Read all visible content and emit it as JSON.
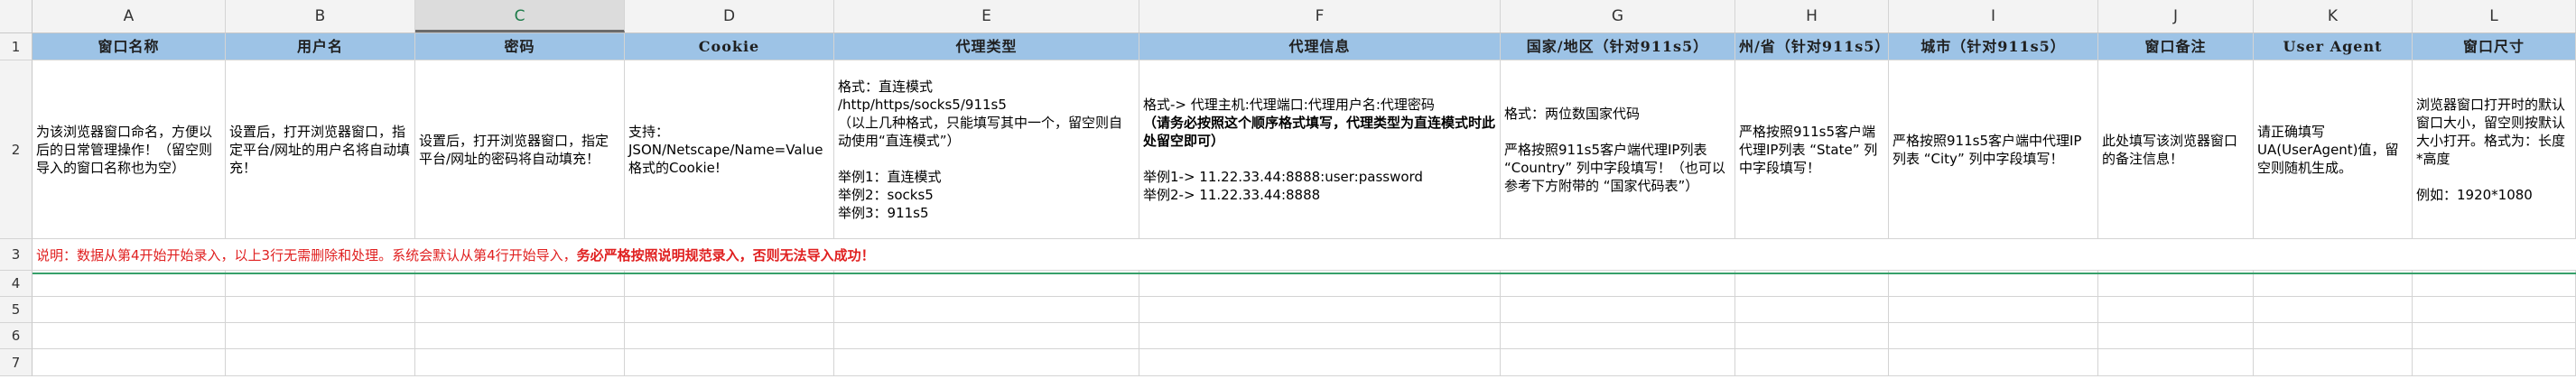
{
  "columns": [
    "A",
    "B",
    "C",
    "D",
    "E",
    "F",
    "G",
    "H",
    "I",
    "J",
    "K",
    "L"
  ],
  "row_numbers": [
    "1",
    "2",
    "3",
    "4",
    "5",
    "6",
    "7"
  ],
  "headers": [
    "窗口名称",
    "用户名",
    "密码",
    "Cookie",
    "代理类型",
    "代理信息",
    "国家/地区（针对911s5）",
    "州/省（针对911s5）",
    "城市（针对911s5）",
    "窗口备注",
    "User Agent",
    "窗口尺寸"
  ],
  "descriptions": {
    "a": "为该浏览器窗口命名，方便以后的日常管理操作！（留空则导入的窗口名称也为空）",
    "b": "设置后，打开浏览器窗口，指定平台/网址的用户名将自动填充！",
    "c": "设置后，打开浏览器窗口，指定平台/网址的密码将自动填充！",
    "d": "支持：\nJSON/Netscape/Name=Value格式的Cookie!",
    "e": "格式：直连模式\n/http/https/socks5/911s5\n（以上几种格式，只能填写其中一个，留空则自动使用“直连模式”）\n\n举例1：直连模式\n举例2：socks5\n举例3：911s5",
    "f_line1": "格式-> 代理主机:代理端口:代理用户名:代理密码",
    "f_bold": "（请务必按照这个顺序格式填写，代理类型为直连模式时此处留空即可）",
    "f_rest": "举例1-> 11.22.33.44:8888:user:password\n举例2-> 11.22.33.44:8888",
    "g": "格式：两位数国家代码\n\n严格按照911s5客户端代理IP列表 “Country” 列中字段填写！（也可以参考下方附带的 “国家代码表”）",
    "h": "严格按照911s5客户端代理IP列表 “State” 列中字段填写！",
    "i": "严格按照911s5客户端中代理IP列表 “City” 列中字段填写！",
    "j": "此处填写该浏览器窗口的备注信息！",
    "k": "请正确填写UA(UserAgent)值，留空则随机生成。",
    "l": "浏览器窗口打开时的默认窗口大小，留空则按默认大小打开。格式为：长度*高度\n\n例如：1920*1080"
  },
  "note": {
    "normal": "说明：数据从第4开始开始录入，以上3行无需删除和处理。系统会默认从第4行开始导入，",
    "bold": "务必严格按照说明规范录入，否则无法导入成功！"
  },
  "colors": {
    "header_bg": "#9dc3e6",
    "note_red": "#e02020",
    "selected_col": "#1d7b49"
  }
}
